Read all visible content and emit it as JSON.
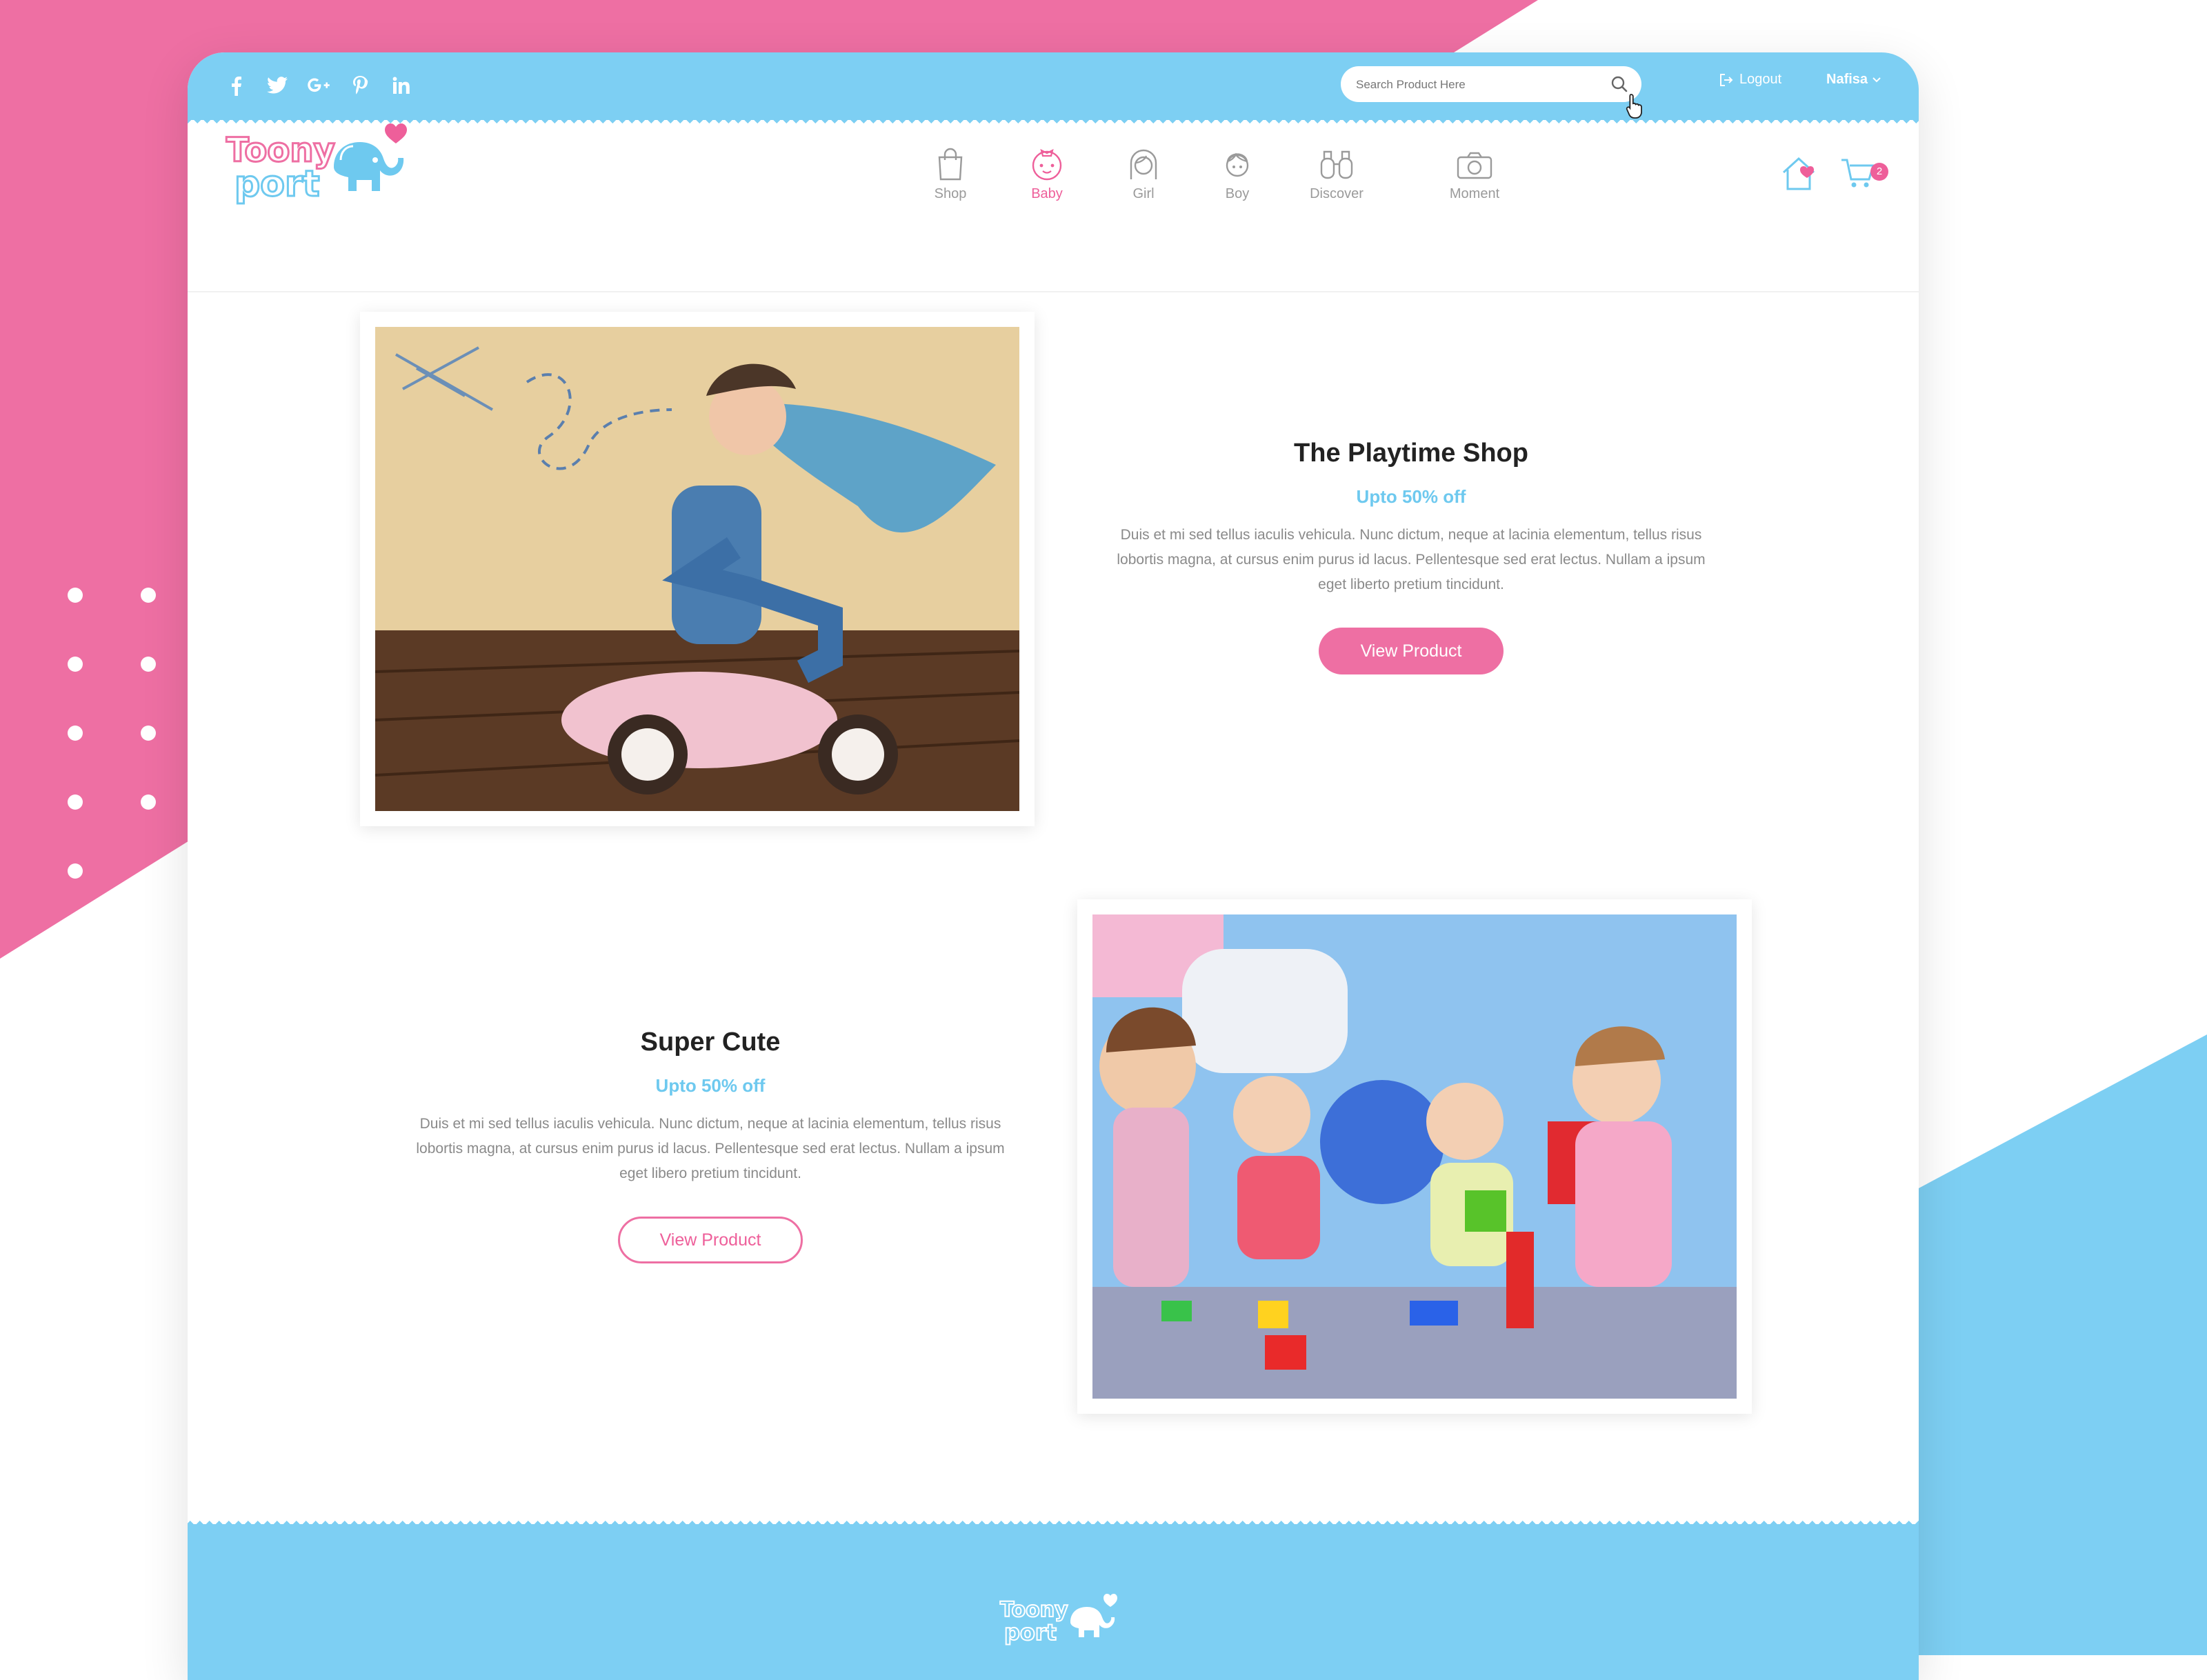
{
  "social": {
    "items": [
      {
        "icon": "facebook-icon",
        "glyph": "f"
      },
      {
        "icon": "twitter-icon",
        "glyph": "t"
      },
      {
        "icon": "google-plus-icon",
        "glyph": "g+"
      },
      {
        "icon": "pinterest-icon",
        "glyph": "p"
      },
      {
        "icon": "linkedin-icon",
        "glyph": "in"
      }
    ]
  },
  "search": {
    "placeholder": "Search Product Here"
  },
  "account": {
    "logout_label": "Logout",
    "user_name": "Nafisa"
  },
  "logo": {
    "line1": "Toony",
    "line2": "port"
  },
  "nav": {
    "items": [
      {
        "label": "Shop",
        "icon": "shopping-bag-icon",
        "active": false
      },
      {
        "label": "Baby",
        "icon": "baby-face-icon",
        "active": true
      },
      {
        "label": "Girl",
        "icon": "girl-face-icon",
        "active": false
      },
      {
        "label": "Boy",
        "icon": "boy-face-icon",
        "active": false
      },
      {
        "label": "Discover",
        "icon": "binoculars-icon",
        "active": false
      },
      {
        "label": "Moment",
        "icon": "camera-icon",
        "active": false
      }
    ]
  },
  "cart": {
    "count": "2"
  },
  "colors": {
    "pink": "#ee6fa3",
    "blue": "#7dcff3",
    "accent_text": "#6ec9ef"
  },
  "promos": [
    {
      "title": "The Playtime Shop",
      "discount": "Upto 50% off",
      "description": "Duis et mi sed tellus iaculis vehicula. Nunc dictum, neque at lacinia elementum, tellus risus lobortis magna, at cursus enim purus id lacus. Pellentesque sed erat lectus. Nullam a ipsum eget liberto pretium tincidunt.",
      "button": "View Product"
    },
    {
      "title": "Super Cute",
      "discount": "Upto 50% off",
      "description": "Duis et mi sed tellus iaculis vehicula. Nunc dictum, neque at lacinia elementum, tellus risus lobortis magna, at cursus enim purus id lacus. Pellentesque sed erat lectus. Nullam a ipsum eget libero pretium tincidunt.",
      "button": "View Product"
    }
  ]
}
